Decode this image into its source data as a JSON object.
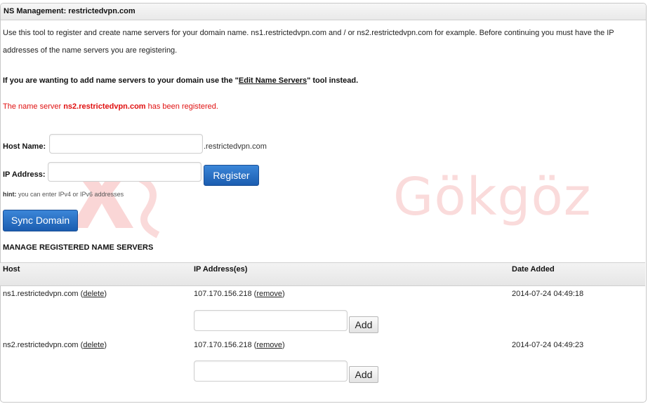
{
  "panel": {
    "title": "NS Management: restrictedvpn.com"
  },
  "intro": {
    "text": "Use this tool to register and create name servers for your domain name. ns1.restrictedvpn.com and / or ns2.restrictedvpn.com for example. Before continuing you must have the IP addresses of the name servers you are registering."
  },
  "tip": {
    "prefix": "If you are wanting to add name servers to your domain use the \"",
    "link": "Edit Name Servers",
    "suffix": "\" tool instead."
  },
  "status": {
    "prefix": "The name server ",
    "host": "ns2.restrictedvpn.com",
    "suffix": " has been registered."
  },
  "form": {
    "host_label": "Host Name:",
    "host_value": "",
    "host_suffix": ".restrictedvpn.com",
    "ip_label": "IP Address:",
    "ip_value": "",
    "register_label": "Register",
    "hint_prefix": "hint:",
    "hint_text": " you can enter IPv4 or IPv6 addresses"
  },
  "sync": {
    "label": "Sync Domain"
  },
  "manage": {
    "title": "MANAGE REGISTERED NAME SERVERS",
    "columns": [
      "Host",
      "IP Address(es)",
      "Date Added"
    ],
    "rows": [
      {
        "host": "ns1.restrictedvpn.com",
        "delete_label": "delete",
        "ip": "107.170.156.218",
        "remove_label": "remove",
        "date": "2014-07-24 04:49:18",
        "add_label": "Add"
      },
      {
        "host": "ns2.restrictedvpn.com",
        "delete_label": "delete",
        "ip": "107.170.156.218",
        "remove_label": "remove",
        "date": "2014-07-24 04:49:23",
        "add_label": "Add"
      }
    ]
  },
  "watermark": {
    "text": "Gökgöz"
  }
}
